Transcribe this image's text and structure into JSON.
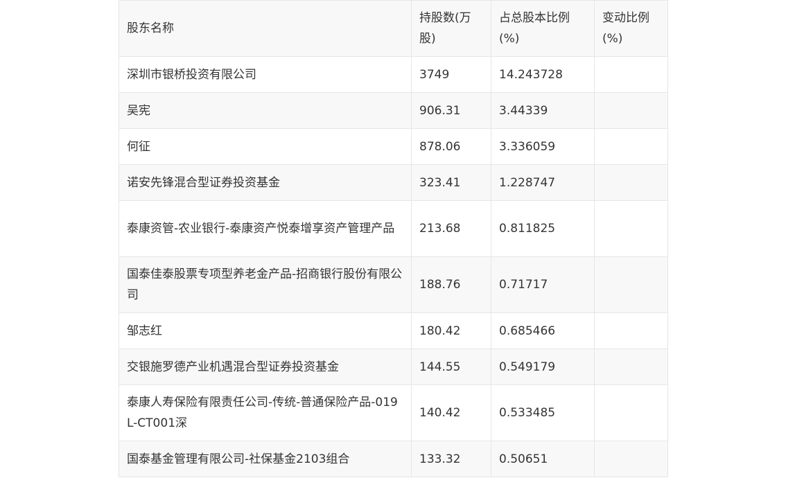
{
  "table": {
    "headers": [
      "股东名称",
      "持股数(万股)",
      "占总股本比例(%)",
      "变动比例(%)"
    ],
    "rows": [
      {
        "name": "深圳市银桥投资有限公司",
        "shares": "3749",
        "ratio": "14.243728",
        "change": ""
      },
      {
        "name": "吴宪",
        "shares": "906.31",
        "ratio": "3.44339",
        "change": ""
      },
      {
        "name": "何征",
        "shares": "878.06",
        "ratio": "3.336059",
        "change": ""
      },
      {
        "name": "诺安先锋混合型证券投资基金",
        "shares": "323.41",
        "ratio": "1.228747",
        "change": ""
      },
      {
        "name": "泰康资管-农业银行-泰康资产悦泰增享资产管理产品",
        "shares": "213.68",
        "ratio": "0.811825",
        "change": ""
      },
      {
        "name": "国泰佳泰股票专项型养老金产品-招商银行股份有限公司",
        "shares": "188.76",
        "ratio": "0.71717",
        "change": ""
      },
      {
        "name": "邹志红",
        "shares": "180.42",
        "ratio": "0.685466",
        "change": ""
      },
      {
        "name": "交银施罗德产业机遇混合型证券投资基金",
        "shares": "144.55",
        "ratio": "0.549179",
        "change": ""
      },
      {
        "name": "泰康人寿保险有限责任公司-传统-普通保险产品-019L-CT001深",
        "shares": "140.42",
        "ratio": "0.533485",
        "change": ""
      },
      {
        "name": "国泰基金管理有限公司-社保基金2103组合",
        "shares": "133.32",
        "ratio": "0.50651",
        "change": ""
      }
    ]
  }
}
